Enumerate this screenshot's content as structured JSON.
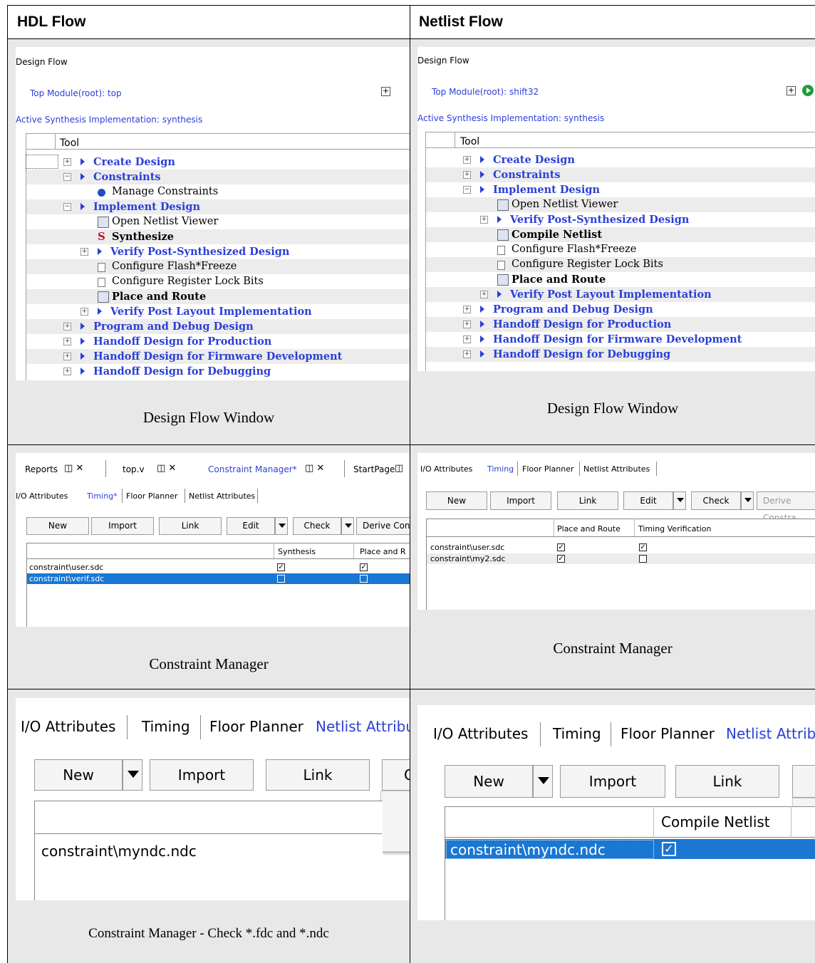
{
  "headers": {
    "left": "HDL Flow",
    "right": "Netlist Flow"
  },
  "captions": {
    "df_left": "Design Flow Window",
    "df_right": "Design Flow Window",
    "cm_left": "Constraint Manager",
    "cm_right": "Constraint Manager",
    "bottom_left": "Constraint Manager - Check *.fdc and *.ndc"
  },
  "df_left": {
    "title": "Design Flow",
    "top_module": "Top Module(root): top",
    "active_synth": "Active Synthesis Implementation: synthesis",
    "tool_header": "Tool",
    "rows": [
      "Create Design",
      "Constraints",
      "Manage Constraints",
      "Implement Design",
      "Open Netlist Viewer",
      "Synthesize",
      "Verify Post-Synthesized Design",
      "Configure Flash*Freeze",
      "Configure Register Lock Bits",
      "Place and Route",
      "Verify Post Layout Implementation",
      "Program and Debug Design",
      "Handoff Design for Production",
      "Handoff Design for Firmware Development",
      "Handoff Design for Debugging"
    ]
  },
  "df_right": {
    "title": "Design Flow",
    "top_module": "Top Module(root): shift32",
    "active_synth": "Active Synthesis Implementation: synthesis",
    "tool_header": "Tool",
    "rows": [
      "Create Design",
      "Constraints",
      "Implement Design",
      "Open Netlist Viewer",
      "Verify Post-Synthesized Design",
      "Compile Netlist",
      "Configure Flash*Freeze",
      "Configure Register Lock Bits",
      "Place and Route",
      "Verify Post Layout Implementation",
      "Program and Debug Design",
      "Handoff Design for Production",
      "Handoff Design for Firmware Development",
      "Handoff Design for Debugging"
    ]
  },
  "cm_left": {
    "doc_tabs": [
      "Reports",
      "top.v",
      "Constraint Manager*",
      "StartPage"
    ],
    "tabs": [
      "I/O Attributes",
      "Timing*",
      "Floor Planner",
      "Netlist Attributes"
    ],
    "buttons": {
      "new": "New",
      "import": "Import",
      "link": "Link",
      "edit": "Edit",
      "check": "Check",
      "derive": "Derive Cons"
    },
    "columns": [
      "Synthesis",
      "Place and R"
    ],
    "files": [
      "constraint\\user.sdc",
      "constraint\\verif.sdc"
    ]
  },
  "cm_right": {
    "tabs": [
      "I/O Attributes",
      "Timing",
      "Floor Planner",
      "Netlist Attributes"
    ],
    "buttons": {
      "new": "New",
      "import": "Import",
      "link": "Link",
      "edit": "Edit",
      "check": "Check",
      "derive": "Derive Constra"
    },
    "columns": [
      "Place and Route",
      "Timing Verification"
    ],
    "files": [
      "constraint\\user.sdc",
      "constraint\\my2.sdc"
    ]
  },
  "bottom_left": {
    "tabs": [
      "I/O Attributes",
      "Timing",
      "Floor Planner",
      "Netlist Attribu"
    ],
    "buttons": {
      "new": "New",
      "import": "Import",
      "link": "Link",
      "partial": "C"
    },
    "file": "constraint\\myndc.ndc"
  },
  "bottom_right": {
    "tabs": [
      "I/O Attributes",
      "Timing",
      "Floor Planner",
      "Netlist Attribu"
    ],
    "buttons": {
      "new": "New",
      "import": "Import",
      "link": "Link"
    },
    "column": "Compile Netlist",
    "file": "constraint\\myndc.ndc"
  }
}
